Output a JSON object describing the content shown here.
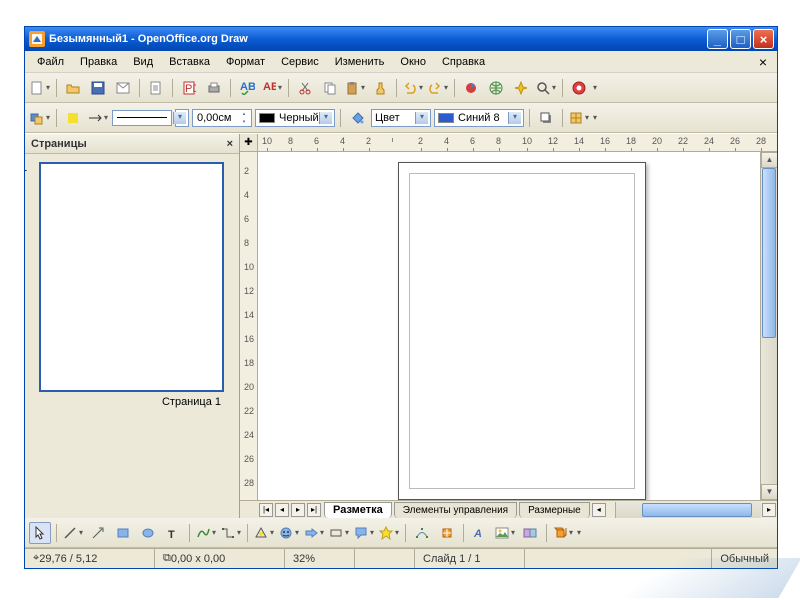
{
  "window": {
    "title": "Безымянный1 - OpenOffice.org Draw"
  },
  "menu": [
    "Файл",
    "Правка",
    "Вид",
    "Вставка",
    "Формат",
    "Сервис",
    "Изменить",
    "Окно",
    "Справка"
  ],
  "toolbar2": {
    "line_width": "0,00см",
    "line_color_label": "Черный",
    "fill_label": "Цвет",
    "fill_color_label": "Синий 8"
  },
  "pages_panel": {
    "title": "Страницы",
    "page_num": "1",
    "page_label": "Страница 1"
  },
  "ruler_h": [
    "10",
    "8",
    "6",
    "4",
    "2",
    "",
    "2",
    "4",
    "6",
    "8",
    "10",
    "12",
    "14",
    "16",
    "18",
    "20",
    "22",
    "24",
    "26",
    "28"
  ],
  "ruler_v": [
    "2",
    "4",
    "6",
    "8",
    "10",
    "12",
    "14",
    "16",
    "18",
    "20",
    "22",
    "24",
    "26",
    "28"
  ],
  "layer_tabs": [
    "Разметка",
    "Элементы управления",
    "Размерные"
  ],
  "status": {
    "pos": "29,76 / 5,12",
    "size": "0,00 x 0,00",
    "zoom": "32%",
    "slide": "Слайд 1 / 1",
    "mode": "Обычный"
  }
}
